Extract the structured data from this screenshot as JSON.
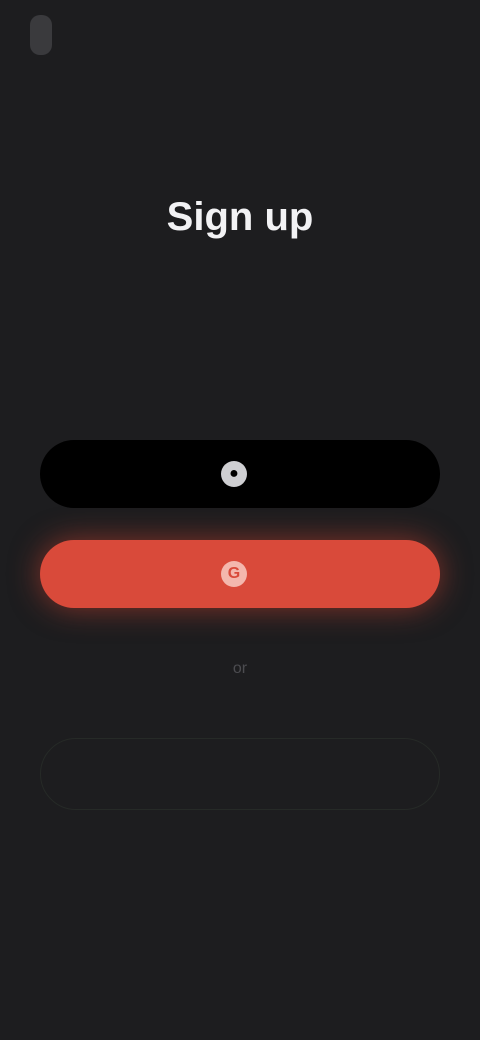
{
  "app": {
    "logo_text": ""
  },
  "signup": {
    "title": "Sign up",
    "subtitle": "",
    "login_prompt": "",
    "login_link": "",
    "apple_button": "",
    "google_button": "",
    "divider": "or",
    "email_button": "",
    "terms_text": "",
    "terms_link": ""
  },
  "colors": {
    "background": "#1d1d1f",
    "google_red": "#d94a3a",
    "apple_black": "#000000",
    "email_green": "#3f8a45",
    "link_blue": "#2f6fd6"
  },
  "icons": {
    "apple": "apple-icon",
    "google": "google-icon"
  }
}
